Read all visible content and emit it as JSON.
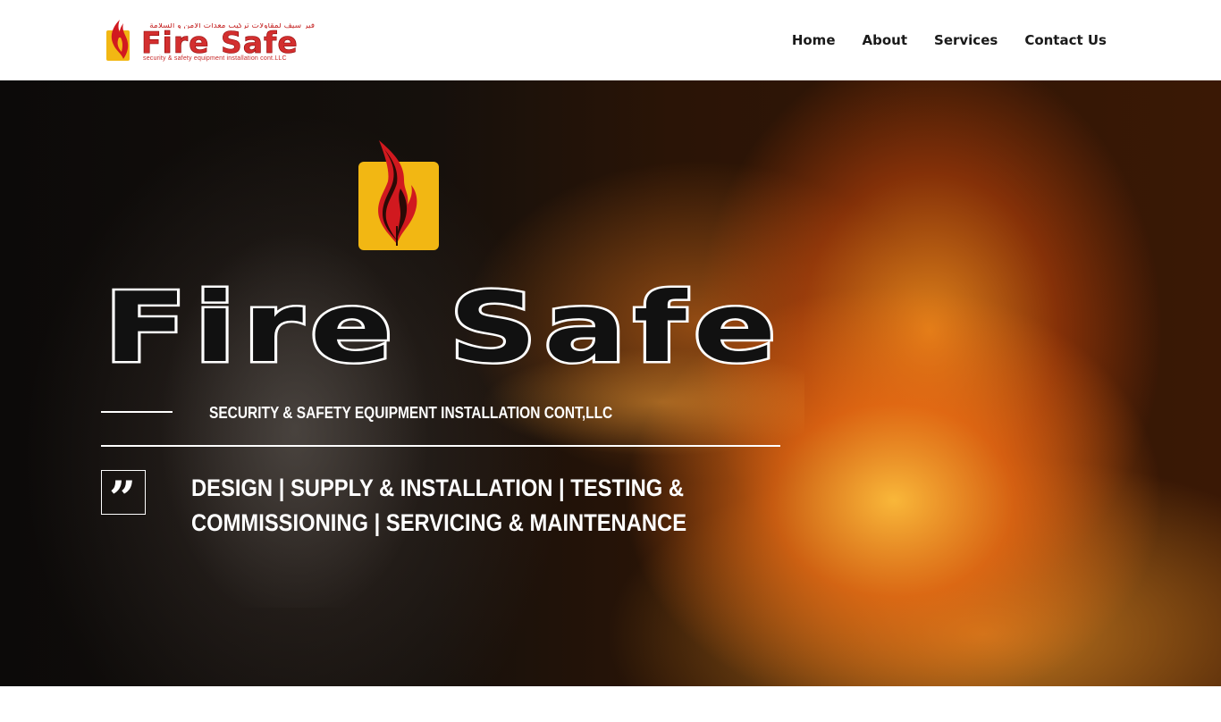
{
  "header": {
    "logo": {
      "arabic": "فير سيف لمقاولات تركيب معدات الأمن و السلامة",
      "brand": "Fire Safe",
      "tagline": "security & safety equipment installation cont.LLC"
    },
    "nav": [
      {
        "label": "Home"
      },
      {
        "label": "About"
      },
      {
        "label": "Services"
      },
      {
        "label": "Contact Us"
      }
    ]
  },
  "hero": {
    "title": "Fire Safe",
    "subtitle": "SECURITY & SAFETY EQUIPMENT INSTALLATION CONT,LLC",
    "services_line1": "DESIGN | SUPPLY & INSTALLATION | TESTING &",
    "services_line2": "COMMISSIONING | SERVICING & MAINTENANCE",
    "quote_icon": "quote-icon"
  },
  "colors": {
    "brand_red": "#d32f2f",
    "logo_yellow": "#f2b713",
    "flame_red": "#d1191f",
    "text_dark": "#1a1a1a"
  }
}
